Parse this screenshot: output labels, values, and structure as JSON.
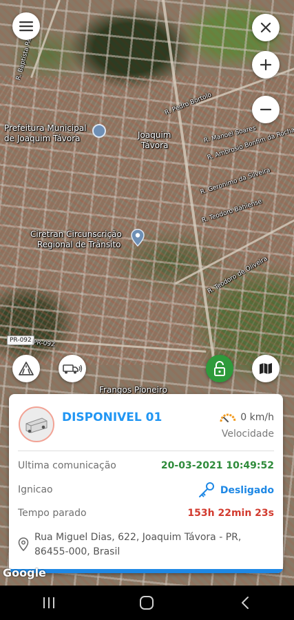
{
  "map": {
    "labels": {
      "prefeitura": "Prefeitura Municipal",
      "prefeitura2": "de Joaquim Távora",
      "city": "Joaquim",
      "city2": "Távora",
      "ciretran": "Ciretran Circunscrição",
      "ciretran2": "Regional de Trânsito",
      "frangos": "Frangos Pioneiro",
      "road_shield": "PR-092",
      "road_label": "PR-092",
      "street1": "R. Pedro Bortolo",
      "street2": "R. Manoel Soares",
      "street3": "R. Ambrosio Bonfim da Rocha",
      "street4": "R. Geronimo da Silveira",
      "street5": "R. Teodoro Bahiense",
      "street6": "R. Teodoro de Oliveira",
      "street7": "R. Baptista Rezende"
    },
    "google": "Google"
  },
  "controls": {
    "menu_icon": "hamburger-menu-icon",
    "close_icon": "close-icon",
    "zoom_in_icon": "plus-icon",
    "zoom_out_icon": "minus-icon",
    "traffic_icon": "traffic-cone-icon",
    "tracking_icon": "truck-signal-icon",
    "lock_icon": "unlocked-padlock-icon",
    "map_type_icon": "map-icon",
    "lock_color": "#2e9a3b"
  },
  "vehicle": {
    "name": "DISPONIVEL 01",
    "speed": "0 km/h",
    "speed_caption": "Velocidade",
    "last_comm_label": "Ultima comunicação",
    "last_comm_value": "20-03-2021 10:49:52",
    "ignition_label": "Ignicao",
    "ignition_value": "Desligado",
    "stopped_label": "Tempo parado",
    "stopped_value": "153h 22min 23s",
    "address": "Rua Miguel Dias, 622, Joaquim Távora - PR, 86455-000, Brasil"
  },
  "colors": {
    "name_blue": "#2196f3",
    "green_value": "#2e8b3a",
    "blue_value": "#1e88e5",
    "red_value": "#d23a2e"
  }
}
